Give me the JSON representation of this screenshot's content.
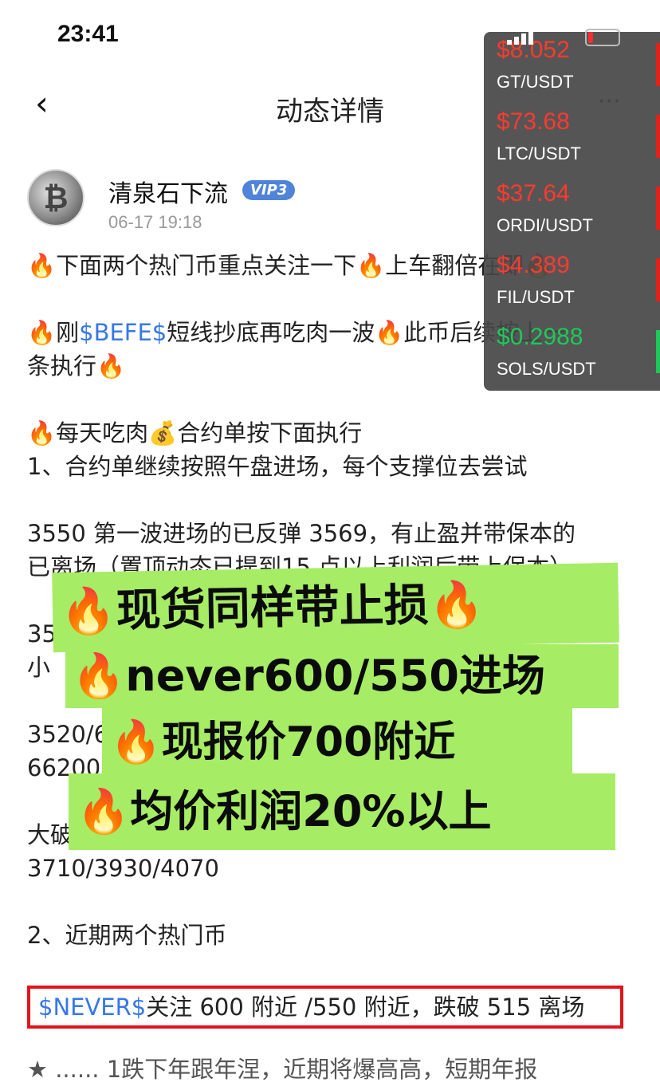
{
  "status": {
    "time": "23:41"
  },
  "nav": {
    "title": "动态详情",
    "back_icon": "chevron-left-icon",
    "more_label": "···"
  },
  "author": {
    "name": "清泉石下流",
    "vip": "VIP3",
    "time": "06-17 19:18",
    "avatar_glyph": "₿"
  },
  "post": {
    "fire": "🔥",
    "bag": "💰",
    "line1": "下面两个热门币重点关注一下",
    "line1_b": "上车翻倍在即",
    "line2_a": "刚",
    "line2_tag": "$BEFE$",
    "line2_b": "短线抄底再吃肉一波",
    "line2_c": "此币后续按上一",
    "line2_d": "条执行",
    "line3_a": "每天吃肉",
    "line3_b": "合约单按下面执行",
    "line4": "1、合约单继续按照午盘进场，每个支撑位去尝试",
    "line5": "3550 第一波进场的已反弹 3569，有止盈并带保本的",
    "line6": "已离场（置顶动态已提到15 点以上利润后带上保本）",
    "line7": "352",
    "line8": "小",
    "line9": "3520/6",
    "line10": "66200/",
    "line11": "大破",
    "line12": "3710/3930/4070",
    "line13": "2、近期两个热门币",
    "hl_tag": "$NEVER$",
    "hl_text": "关注 600 附近 /550 附近，跌破 515 离场",
    "line14": "★ ...... 1跌下年跟年涅，近期将爆高高，短期年报"
  },
  "ticker": [
    {
      "price": "$8.052",
      "pair": "GT/USDT",
      "dir": "down"
    },
    {
      "price": "$73.68",
      "pair": "LTC/USDT",
      "dir": "down"
    },
    {
      "price": "$37.64",
      "pair": "ORDI/USDT",
      "dir": "down"
    },
    {
      "price": "$4.389",
      "pair": "FIL/USDT",
      "dir": "down"
    },
    {
      "price": "$0.2988",
      "pair": "SOLS/USDT",
      "dir": "up"
    }
  ],
  "stickers": {
    "fire": "🔥",
    "s1": "现货同样带止损",
    "s2": "never600/550进场",
    "s3": "现报价700附近",
    "s4": "均价利润20%以上"
  }
}
